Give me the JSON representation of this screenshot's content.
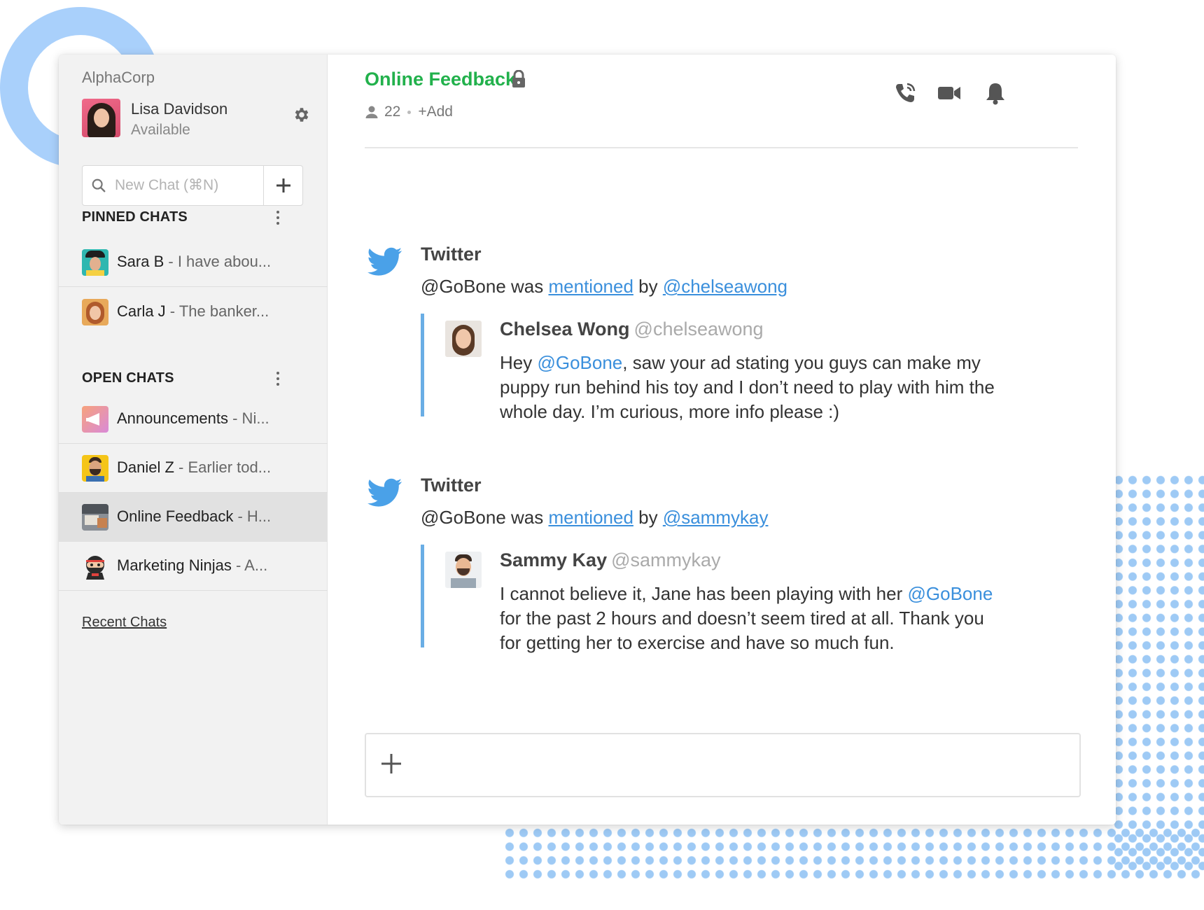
{
  "sidebar": {
    "workspace": "AlphaCorp",
    "user": {
      "name": "Lisa Davidson",
      "status": "Available"
    },
    "search": {
      "placeholder": "New Chat (⌘N)"
    },
    "pinned": {
      "heading": "PINNED CHATS",
      "items": [
        {
          "name": "Sara B",
          "preview": " - I have abou..."
        },
        {
          "name": "Carla J",
          "preview": " - The banker..."
        }
      ]
    },
    "open": {
      "heading": "OPEN CHATS",
      "items": [
        {
          "name": "Announcements",
          "preview": " - Ni..."
        },
        {
          "name": "Daniel Z",
          "preview": " - Earlier tod..."
        },
        {
          "name": "Online Feedback",
          "preview": " - H...",
          "active": true
        },
        {
          "name": "Marketing Ninjas",
          "preview": " - A..."
        }
      ]
    },
    "recent_link": "Recent Chats"
  },
  "channel": {
    "title": "Online Feedback",
    "member_count": "22",
    "add_label": "+Add",
    "icons": [
      "phone-icon",
      "video-camera-icon",
      "bell-icon"
    ]
  },
  "messages": [
    {
      "source": "Twitter",
      "prefix": "@GoBone was ",
      "link_text": "mentioned",
      "by": " by ",
      "handle_link": "@chelseawong",
      "quote": {
        "name": "Chelsea Wong",
        "handle": "@chelseawong",
        "text_before": "Hey ",
        "mention": "@GoBone",
        "text_after": ", saw your ad stating you guys can make my puppy run behind his toy and I don’t need to play with him the whole day. I’m curious, more info please :)"
      }
    },
    {
      "source": "Twitter",
      "prefix": "@GoBone was ",
      "link_text": "mentioned",
      "by": " by ",
      "handle_link": "@sammykay",
      "quote": {
        "name": "Sammy Kay",
        "handle": "@sammykay",
        "text_before": "I cannot believe it, Jane has been playing with her ",
        "mention": "@GoBone",
        "text_after": " for the past 2 hours and doesn’t seem tired at all. Thank you for getting her to exercise and have so much fun."
      }
    }
  ],
  "colors": {
    "channel_title": "#22b14c",
    "link": "#3a8fdc",
    "quote_bar": "#6aaee5",
    "twitter": "#4aa1e8",
    "decoration": "#a9d0fb"
  }
}
